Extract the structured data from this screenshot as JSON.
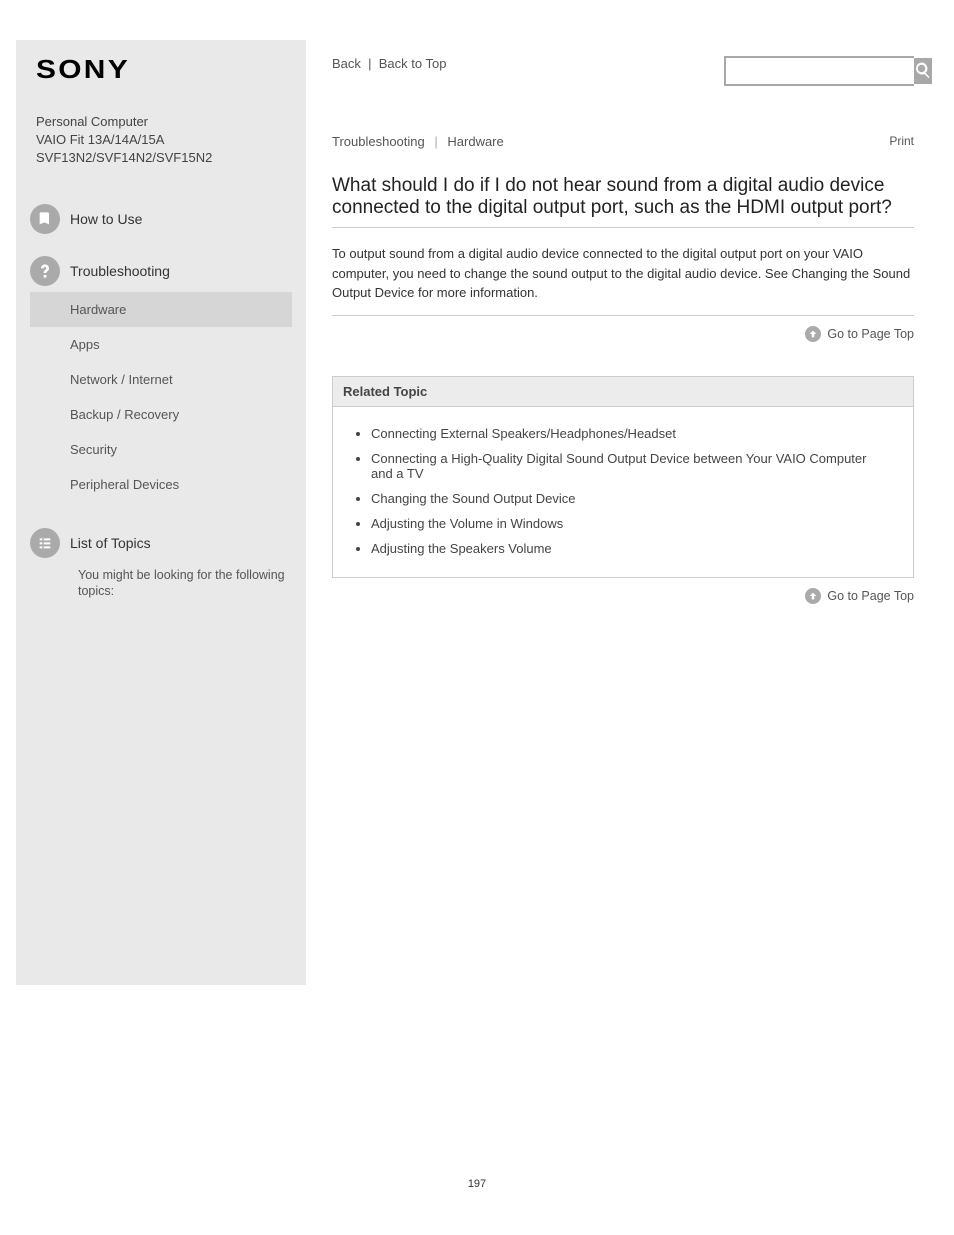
{
  "brand": "SONY",
  "sidebar": {
    "title_line1": "Personal Computer",
    "title_line2": "VAIO Fit 13A/14A/15A",
    "model": "SVF13N2/SVF14N2/SVF15N2",
    "how_to_use": "How to Use",
    "troubleshooting": "Troubleshooting",
    "hardware": "Hardware",
    "apps": "Apps",
    "network": "Network / Internet",
    "backup": "Backup / Recovery",
    "security": "Security",
    "peripheral": "Peripheral Devices",
    "other_heading": "List of Topics",
    "other_link": "You might be looking for the following topics:"
  },
  "header": {
    "back": "Back",
    "back_to_top": "Back to Top",
    "print": "Print"
  },
  "search": {
    "placeholder": ""
  },
  "crumb": {
    "a": "Troubleshooting",
    "b": "Hardware"
  },
  "page_title": "What should I do if I do not hear sound from a digital audio device connected to the digital output port, such as the HDMI output port?",
  "body_text": "To output sound from a digital audio device connected to the digital output port on your VAIO computer, you need to change the sound output to the digital audio device. See Changing the Sound Output Device for more information.",
  "goto_label": "Go to Page Top",
  "related": {
    "heading": "Related Topic",
    "items": [
      "Connecting External Speakers/Headphones/Headset",
      "Connecting a High-Quality Digital Sound Output Device between Your VAIO Computer and a TV",
      "Changing the Sound Output Device",
      "Adjusting the Volume in Windows",
      "Adjusting the Speakers Volume"
    ]
  },
  "page_number": "197"
}
